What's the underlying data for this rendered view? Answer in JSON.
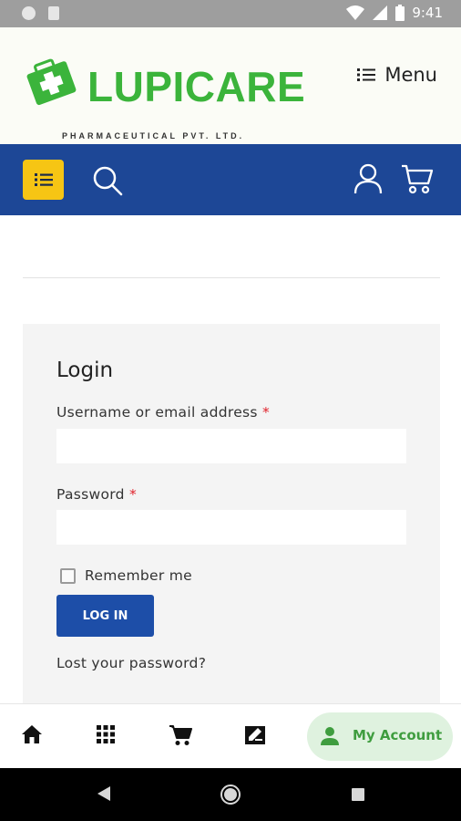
{
  "status_bar": {
    "time": "9:41"
  },
  "header": {
    "logo_text": "LUPICARE",
    "logo_subtitle": "PHARMACEUTICAL PVT. LTD.",
    "menu_label": "Menu",
    "brand_green": "#3bb43b"
  },
  "navbar": {
    "icons": [
      "list-icon",
      "search-icon",
      "user-icon",
      "cart-icon"
    ],
    "bg_color": "#1d4796",
    "accent_color": "#f6c514"
  },
  "login": {
    "title": "Login",
    "username_label": "Username or email address",
    "password_label": "Password",
    "required_mark": "*",
    "username_value": "",
    "password_value": "",
    "remember_label": "Remember me",
    "remember_checked": false,
    "login_button": "LOG IN",
    "lost_password": "Lost your password?"
  },
  "bottom_nav": {
    "items": [
      {
        "icon": "home-icon"
      },
      {
        "icon": "grid-icon"
      },
      {
        "icon": "cart-icon"
      },
      {
        "icon": "edit-icon"
      }
    ],
    "active_label": "My Account",
    "active_icon": "person-icon",
    "active_color": "#3f9d3f"
  }
}
